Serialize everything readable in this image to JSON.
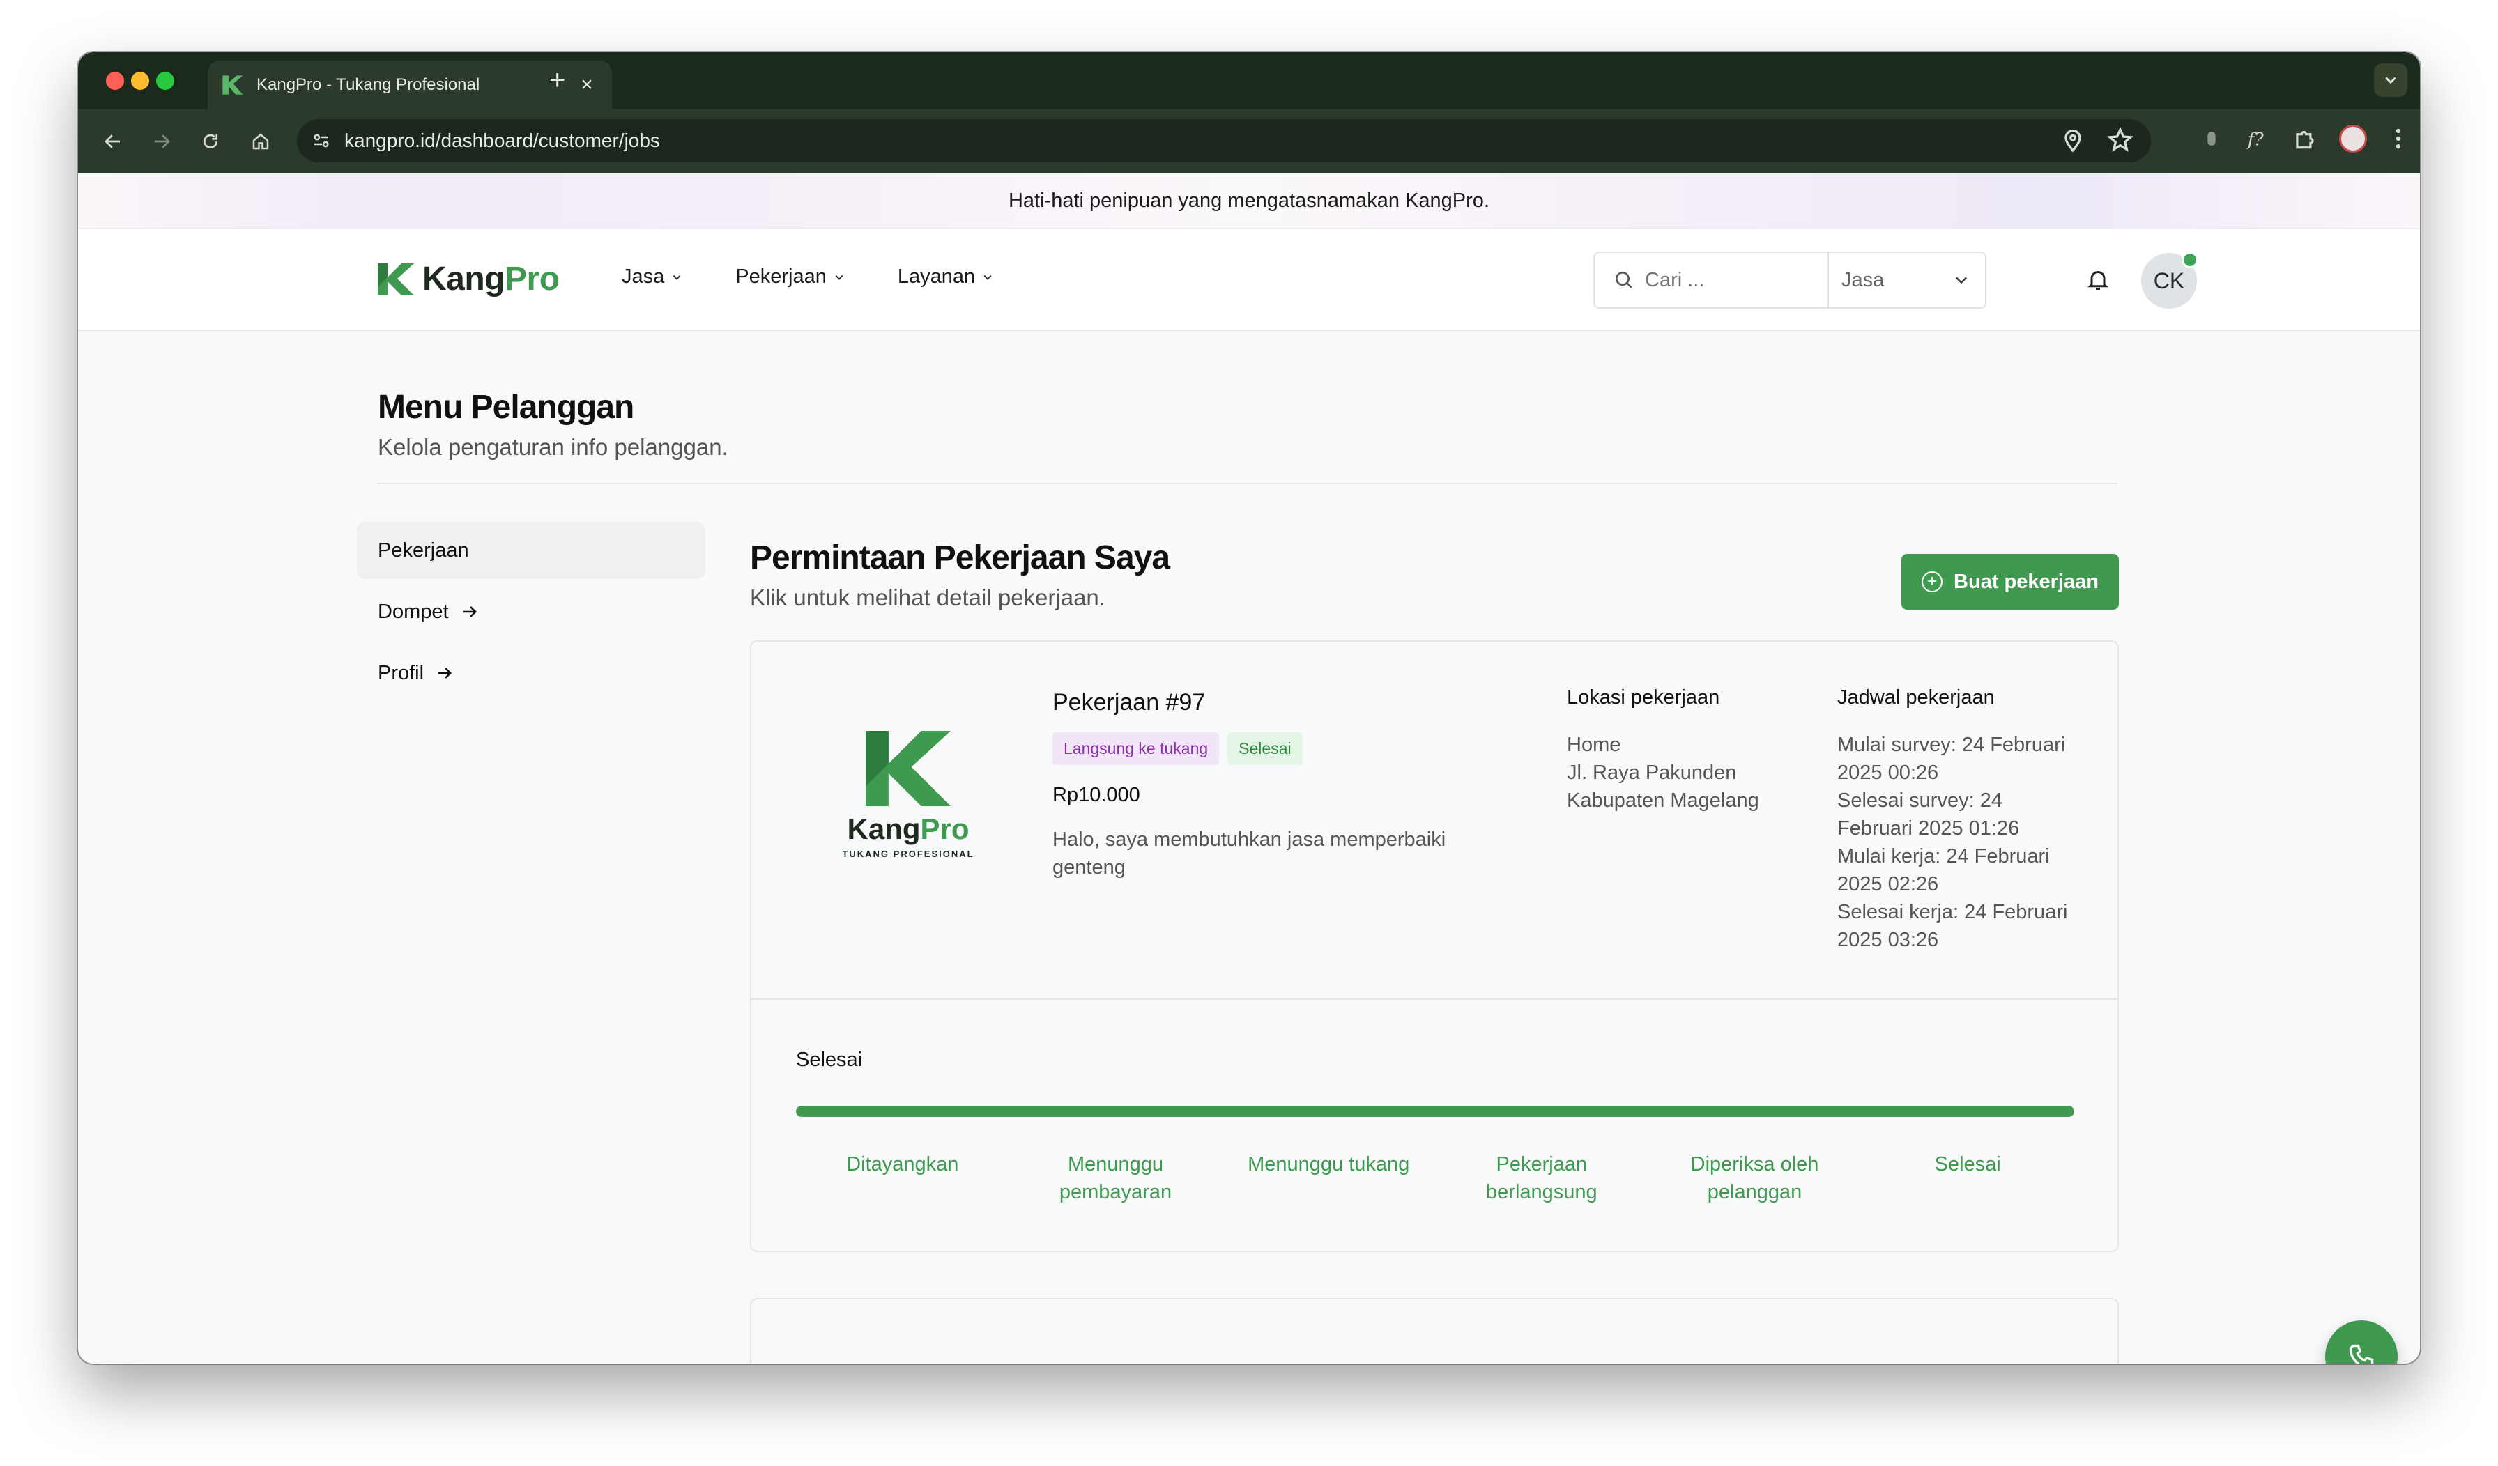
{
  "browser": {
    "tab_title": "KangPro - Tukang Profesional",
    "url": "kangpro.id/dashboard/customer/jobs"
  },
  "banner": {
    "text": "Hati-hati penipuan yang mengatasnamakan KangPro."
  },
  "header": {
    "logo_left": "Kang",
    "logo_right": "Pro",
    "nav": [
      {
        "label": "Jasa"
      },
      {
        "label": "Pekerjaan"
      },
      {
        "label": "Layanan"
      }
    ],
    "search_placeholder": "Cari ...",
    "search_category": "Jasa",
    "user_initials": "CK"
  },
  "page": {
    "title": "Menu Pelanggan",
    "subtitle": "Kelola pengaturan info pelanggan."
  },
  "sidebar": {
    "items": [
      {
        "label": "Pekerjaan",
        "active": true
      },
      {
        "label": "Dompet",
        "active": false
      },
      {
        "label": "Profil",
        "active": false
      }
    ]
  },
  "jobs_section": {
    "title": "Permintaan Pekerjaan Saya",
    "subtitle": "Klik untuk melihat detail pekerjaan.",
    "create_button": "Buat pekerjaan"
  },
  "job": {
    "logo_word_left": "Kang",
    "logo_word_right": "Pro",
    "logo_tagline": "TUKANG PROFESIONAL",
    "title": "Pekerjaan #97",
    "badge_type": "Langsung ke tukang",
    "badge_status": "Selesai",
    "price": "Rp10.000",
    "description": "Halo, saya membutuhkan jasa memperbaiki genteng",
    "location_heading": "Lokasi pekerjaan",
    "location_lines": [
      "Home",
      "Jl. Raya Pakunden",
      "Kabupaten Magelang"
    ],
    "schedule_heading": "Jadwal pekerjaan",
    "schedule_lines": [
      "Mulai survey: 24 Februari",
      "2025 00:26",
      "Selesai survey: 24",
      "Februari 2025 01:26",
      "Mulai kerja: 24 Februari",
      "2025 02:26",
      "Selesai kerja: 24 Februari",
      "2025 03:26"
    ],
    "status_label": "Selesai",
    "progress_percent": 100,
    "steps": [
      "Ditayangkan",
      "Menunggu pembayaran",
      "Menunggu tukang",
      "Pekerjaan berlangsung",
      "Diperiksa oleh pelanggan",
      "Selesai"
    ]
  },
  "colors": {
    "brand_green": "#3f9a4f",
    "badge_purple_bg": "#f1e6f7",
    "badge_green_bg": "#e4f5e6"
  },
  "icons": [
    "search-icon",
    "bell-icon",
    "phone-icon",
    "arrow-right-icon",
    "chevron-down-icon",
    "plus-circle-icon"
  ]
}
